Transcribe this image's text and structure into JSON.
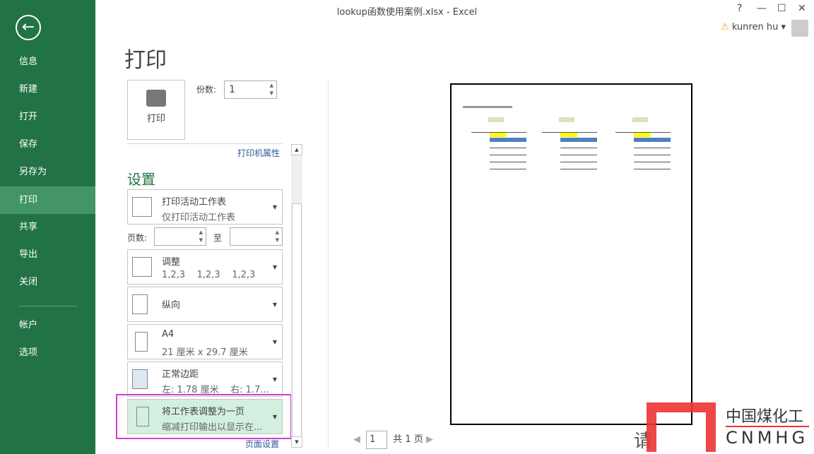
{
  "window": {
    "title": "lookup函数使用案例.xlsx - Excel",
    "help": "?",
    "minimize": "—",
    "maximize": "☐",
    "close": "✕",
    "user": "kunren hu"
  },
  "sidebar": {
    "items": [
      {
        "label": "信息"
      },
      {
        "label": "新建"
      },
      {
        "label": "打开"
      },
      {
        "label": "保存"
      },
      {
        "label": "另存为"
      },
      {
        "label": "打印"
      },
      {
        "label": "共享"
      },
      {
        "label": "导出"
      },
      {
        "label": "关闭"
      },
      {
        "label": "帐户"
      },
      {
        "label": "选项"
      }
    ],
    "active": "打印"
  },
  "main": {
    "title": "打印",
    "print_button": "打印",
    "copies_label": "份数:",
    "copies_value": "1",
    "printer_properties": "打印机属性",
    "settings_heading": "设置",
    "settings": [
      {
        "title": "打印活动工作表",
        "sub": "仅打印活动工作表"
      },
      {
        "title": "调整",
        "sub": "1,2,3    1,2,3    1,2,3"
      },
      {
        "title": "纵向",
        "sub": ""
      },
      {
        "title": "A4",
        "sub": "21 厘米 x 29.7 厘米"
      },
      {
        "title": "正常边距",
        "sub": "左: 1.78 厘米    右: 1.7..."
      },
      {
        "title": "将工作表调整为一页",
        "sub": "缩减打印输出以显示在..."
      }
    ],
    "pages_label": "页数:",
    "pages_to": "至",
    "page_setup": "页面设置"
  },
  "preview": {
    "current_page": "1",
    "total": "共 1 页"
  },
  "watermark": {
    "brand_cn": "中国煤化工",
    "brand_en": "CNMHG",
    "hint": "请"
  }
}
